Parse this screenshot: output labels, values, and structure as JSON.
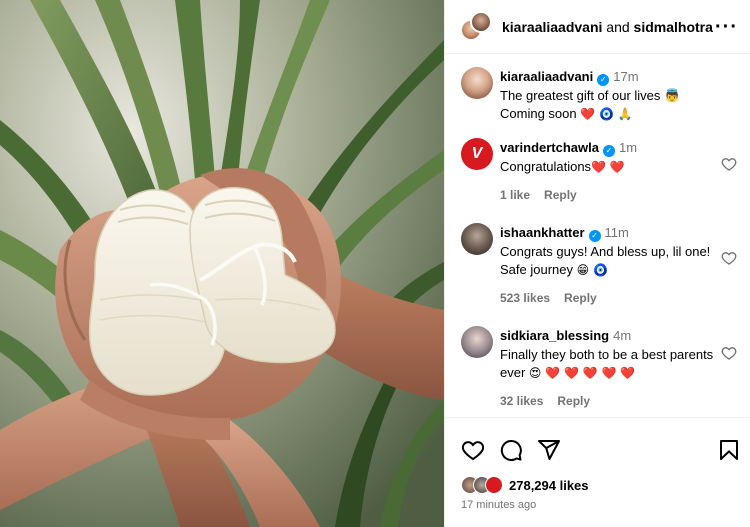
{
  "header": {
    "user1": "kiaraaliaadvani",
    "joiner": "and",
    "user2": "sidmalhotra",
    "more_icon": "more-icon"
  },
  "caption": {
    "user": "kiaraaliaadvani",
    "time": "17m",
    "line1": "The greatest gift of our lives 👼",
    "line2": "Coming soon",
    "line2_emojis": "❤️ 🧿 🙏"
  },
  "comments": [
    {
      "user": "varindertchawla",
      "time": "1m",
      "text": "Congratulations",
      "emojis": "❤️ ❤️",
      "likes": "1 like",
      "reply": "Reply"
    },
    {
      "user": "ishaankhatter",
      "time": "11m",
      "text": "Congrats guys! And bless up, lil one! Safe journey",
      "emojis": "😁 🧿",
      "likes": "523 likes",
      "reply": "Reply"
    },
    {
      "user": "sidkiara_blessing",
      "time": "4m",
      "text": "Finally they both to be a best parents ever",
      "emojis": "😍 ❤️ ❤️ ❤️ ❤️ ❤️",
      "likes": "32 likes",
      "reply": "Reply"
    }
  ],
  "footer": {
    "likes_count": "278,294 likes",
    "time_ago": "17 minutes ago"
  },
  "icons": [
    "heart-icon",
    "comment-icon",
    "share-icon",
    "bookmark-icon",
    "verified-icon",
    "more-icon"
  ],
  "colors": {
    "verified": "#0095f6",
    "meta_gray": "#737373",
    "heart_red": "#e0245e"
  }
}
